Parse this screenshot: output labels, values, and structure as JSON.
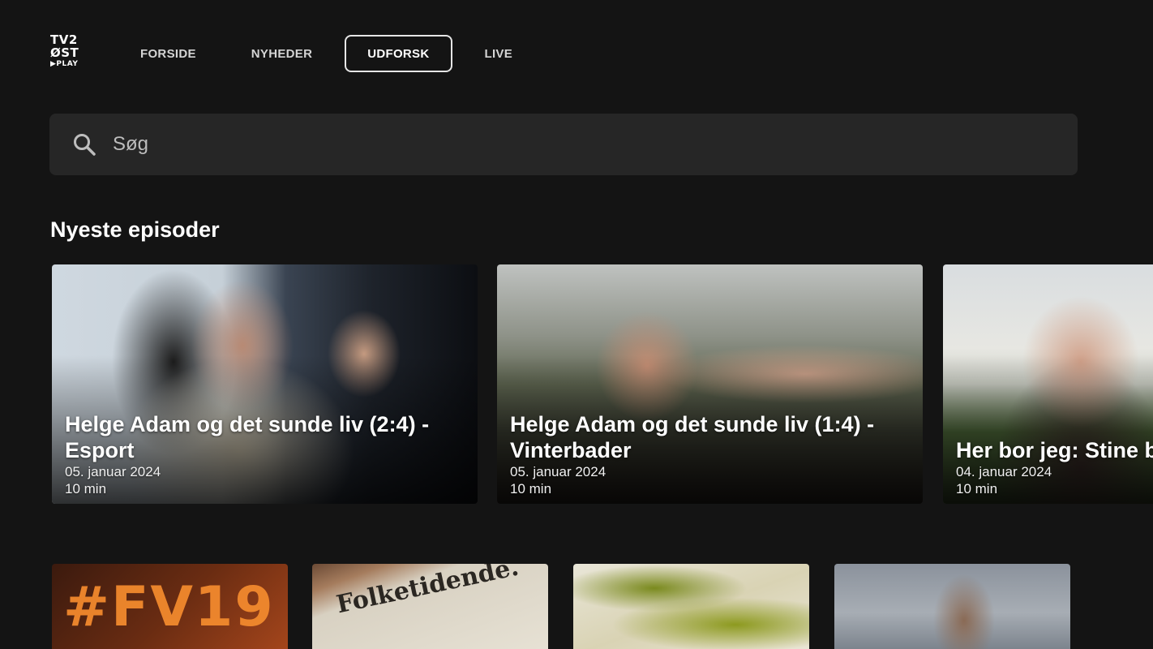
{
  "logo": {
    "line1": "TV2",
    "line2": "ØST",
    "line3": "▶PLAY"
  },
  "nav": {
    "items": [
      {
        "label": "FORSIDE"
      },
      {
        "label": "NYHEDER"
      },
      {
        "label": "UDFORSK",
        "active": true
      },
      {
        "label": "LIVE"
      }
    ]
  },
  "search": {
    "placeholder": "Søg",
    "icon": "search-icon"
  },
  "section": {
    "title": "Nyeste episoder"
  },
  "episodes": [
    {
      "title_line1": "Helge Adam og det sunde liv (2:4) -",
      "title_line2": "Esport",
      "date": "05. januar 2024",
      "duration": "10 min"
    },
    {
      "title_line1": "Helge Adam og det sunde liv (1:4) -",
      "title_line2": "Vinterbader",
      "date": "05. januar 2024",
      "duration": "10 min"
    },
    {
      "title_line1": "Her bor jeg: Stine b",
      "date": "04. januar 2024",
      "duration": "10 min"
    }
  ],
  "tiles": [
    {
      "text": "#FV19"
    },
    {
      "text": "Folketidende."
    },
    {
      "text": ""
    },
    {
      "text": ""
    }
  ],
  "colors": {
    "background": "#141414",
    "search_bg": "#262626",
    "accent_orange": "#f28a2e"
  }
}
